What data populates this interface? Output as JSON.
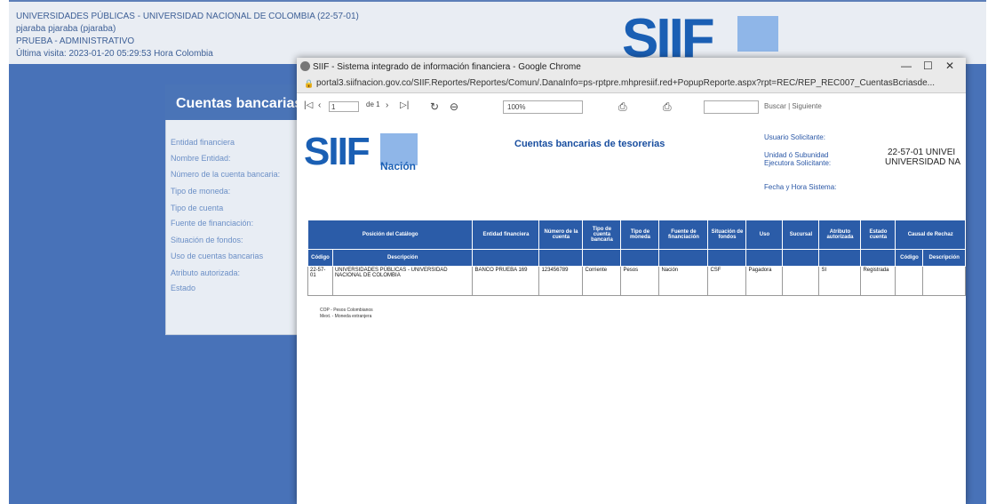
{
  "background": {
    "header_lines": [
      "UNIVERSIDADES PÚBLICAS - UNIVERSIDAD NACIONAL DE COLOMBIA (22-57-01)",
      "pjaraba pjaraba (pjaraba)",
      "PRUEBA - ADMINISTRATIVO",
      "Última visita: 2023-01-20 05:29:53 Hora Colombia"
    ],
    "logo": "SIIF",
    "panel_title": "Cuentas bancarias",
    "panel_fields": [
      "Entidad financiera",
      "Nombre Entidad:",
      "Número de la cuenta bancaria:",
      "Tipo de moneda:",
      "Tipo de cuenta",
      "Fuente de financiación:",
      "Situación de fondos:",
      "Uso de cuentas bancarias",
      "Atributo autorizada:",
      "Estado"
    ]
  },
  "window": {
    "title": "SIIF - Sistema integrado de información financiera - Google Chrome",
    "url": "portal3.siifnacion.gov.co/SIIF.Reportes/Reportes/Comun/.DanaInfo=ps-rptpre.mhpresiif.red+PopupReporte.aspx?rpt=REC/REP_REC007_CuentasBcriasde..."
  },
  "toolbar": {
    "page": "1",
    "of_label": "de 1",
    "zoom": "100%",
    "search_label": "Buscar | Siguiente"
  },
  "report": {
    "logo": "SIIF",
    "logo_sub": "Nación",
    "title": "Cuentas bancarias de tesorerias",
    "usuario_label": "Usuario Solicitante:",
    "unidad_label": "Unidad ó Subunidad Ejecutora Solicitante:",
    "unidad_value_1": "22-57-01 UNIVEI",
    "unidad_value_2": "UNIVERSIDAD NA",
    "fecha_label": "Fecha y Hora Sistema:",
    "legend": [
      "COP - Pesos Colombianos",
      "Mext. - Moneda extranjera"
    ]
  },
  "table": {
    "headers": [
      "Posición del Catálogo",
      "Entidad financiera",
      "Número de la cuenta",
      "Tipo de cuenta bancaria",
      "Tipo de moneda",
      "Fuente de financiación",
      "Situación de fondos",
      "Uso",
      "Sucursal",
      "Atributo autorizada",
      "Estado cuenta",
      "Causal de Rechaz"
    ],
    "subheaders": [
      "Código",
      "Descripción",
      "Código",
      "Descripción"
    ],
    "row": [
      "22-57-01",
      "UNIVERSIDADES PÚBLICAS - UNIVERSIDAD NACIONAL DE COLOMBIA",
      "BANCO PRUEBA 169",
      "123456789",
      "Corriente",
      "Pesos",
      "Nación",
      "CSF",
      "Pagadora",
      "",
      "SI",
      "Registrada",
      "",
      ""
    ]
  }
}
